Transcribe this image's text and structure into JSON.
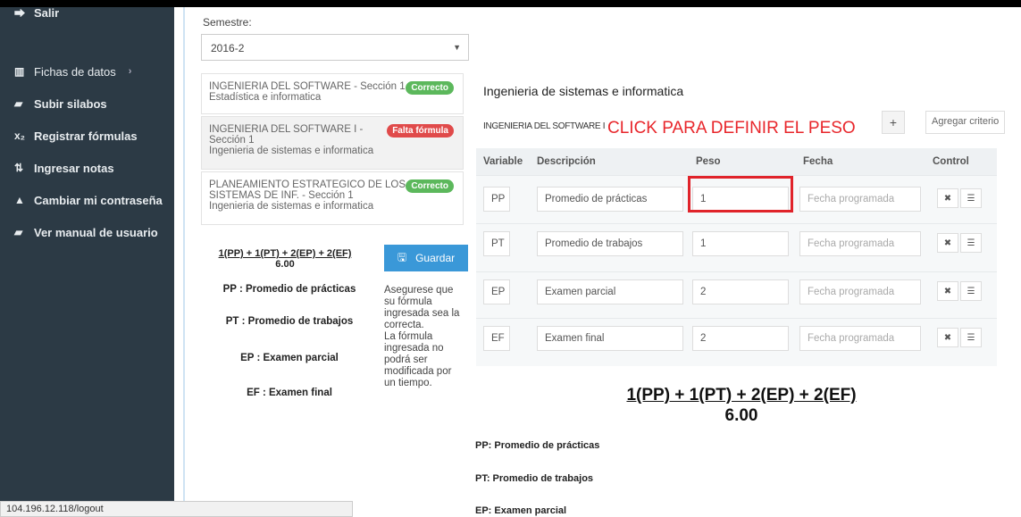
{
  "sidebar": {
    "items": [
      {
        "icon": "logout-icon",
        "glyph": "⮕",
        "label": "Salir"
      },
      {
        "icon": "chart-icon",
        "glyph": "▥",
        "label": "Fichas de datos",
        "chevron": "›"
      },
      {
        "icon": "book-icon",
        "glyph": "▰",
        "label": "Subir silabos"
      },
      {
        "icon": "subscript-icon",
        "glyph": "x₂",
        "label": "Registrar fórmulas"
      },
      {
        "icon": "sort-numeric-icon",
        "glyph": "⇅",
        "label": "Ingresar notas"
      },
      {
        "icon": "lock-icon",
        "glyph": "▲",
        "label": "Cambiar mi contraseña"
      },
      {
        "icon": "book-icon",
        "glyph": "▰",
        "label": "Ver manual de usuario"
      }
    ]
  },
  "status_url": "104.196.12.118/logout",
  "semester": {
    "label": "Semestre:",
    "value": "2016-2"
  },
  "courses": [
    {
      "title": "INGENIERIA DEL SOFTWARE - Sección 1",
      "dept": "Estadística e informatica",
      "badge": "Correcto",
      "status": "ok"
    },
    {
      "title": "INGENIERIA DEL SOFTWARE I -",
      "section": "Sección 1",
      "dept": "Ingenieria de sistemas e informatica",
      "badge": "Falta fórmula",
      "status": "err"
    },
    {
      "title": "PLANEAMIENTO ESTRATEGICO DE LOS",
      "title2": "SISTEMAS DE INF. - Sección 1",
      "dept": "Ingenieria de sistemas e informatica",
      "badge": "Correcto",
      "status": "ok"
    }
  ],
  "formula": {
    "expression": "1(PP) + 1(PT) + 2(EP) + 2(EF)",
    "value": "6.00"
  },
  "save_label": "Guardar",
  "definitions": {
    "left": [
      "PP : Promedio de prácticas",
      "PT : Promedio de trabajos",
      "EP : Examen parcial",
      "EF : Examen final"
    ],
    "right": [
      "PP: Promedio de prácticas",
      "PT: Promedio de trabajos",
      "EP: Examen parcial"
    ]
  },
  "note": [
    "Asegurese que",
    "su fórmula",
    "ingresada sea la",
    "correcta.",
    "La fórmula",
    "ingresada no",
    "podrá ser",
    "modificada por",
    "un tiempo."
  ],
  "department": "Ingenieria de sistemas e informatica",
  "course_name": "INGENIERIA DEL SOFTWARE I",
  "annotation": "CLICK PARA DEFINIR EL PESO",
  "add_criterion_label": "Agregar criterio",
  "table": {
    "headers": [
      "Variable",
      "Descripción",
      "Peso",
      "Fecha",
      "Control"
    ],
    "date_placeholder": "Fecha programada",
    "rows": [
      {
        "variable": "PP",
        "description": "Promedio de prácticas",
        "weight": "1"
      },
      {
        "variable": "PT",
        "description": "Promedio de trabajos",
        "weight": "1"
      },
      {
        "variable": "EP",
        "description": "Examen parcial",
        "weight": "2"
      },
      {
        "variable": "EF",
        "description": "Examen final",
        "weight": "2"
      }
    ]
  },
  "colors": {
    "sidebar_bg": "#2c3a45",
    "accent": "#3a98d8",
    "badge_ok": "#5cb85c",
    "badge_err": "#e04a4a",
    "annotation": "#e8262b"
  }
}
